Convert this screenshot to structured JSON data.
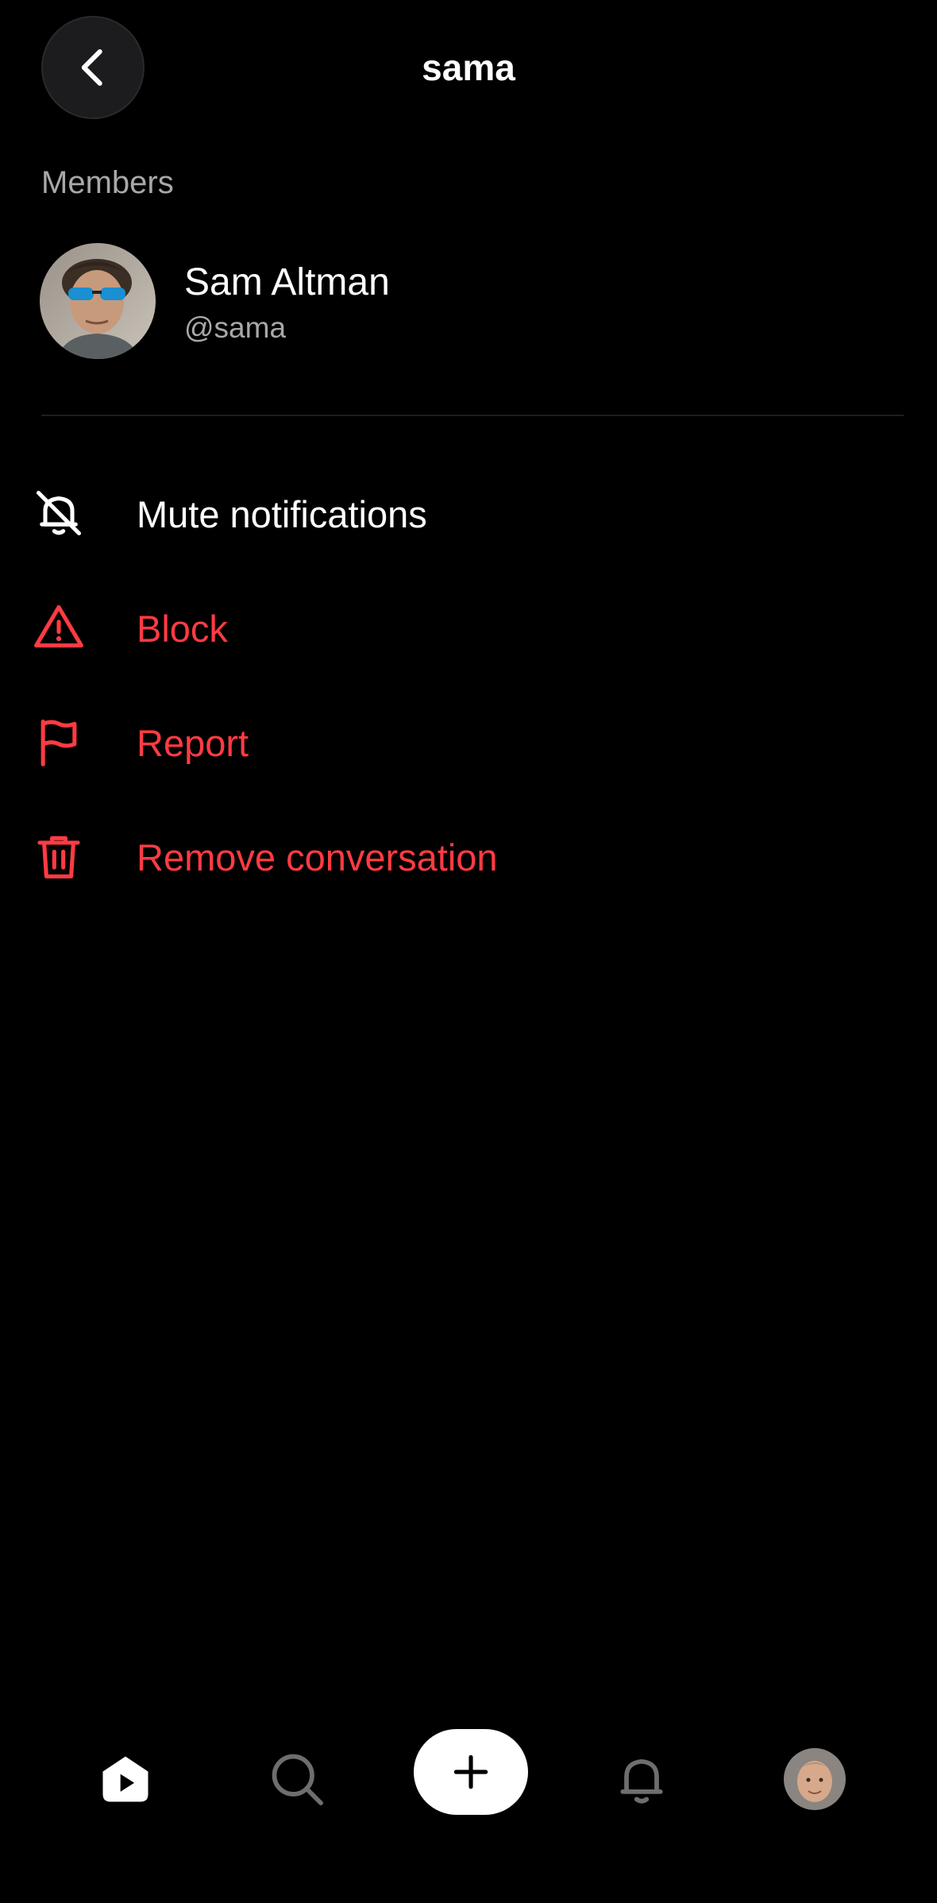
{
  "header": {
    "title": "sama",
    "back_icon": "chevron-left-icon"
  },
  "members": {
    "section_label": "Members",
    "items": [
      {
        "name": "Sam Altman",
        "handle": "@sama"
      }
    ]
  },
  "actions": [
    {
      "label": "Mute notifications",
      "icon": "bell-off-icon",
      "color": "#ffffff"
    },
    {
      "label": "Block",
      "icon": "warning-triangle-icon",
      "color": "#ff3b43"
    },
    {
      "label": "Report",
      "icon": "flag-icon",
      "color": "#ff3b43"
    },
    {
      "label": "Remove conversation",
      "icon": "trash-icon",
      "color": "#ff3b43"
    }
  ],
  "tabbar": {
    "items": [
      "home-play-icon",
      "search-icon",
      "plus-icon",
      "bell-icon",
      "profile-avatar"
    ]
  },
  "colors": {
    "background": "#000000",
    "destructive": "#ff3b43",
    "secondary_text": "#a8a8a8"
  }
}
